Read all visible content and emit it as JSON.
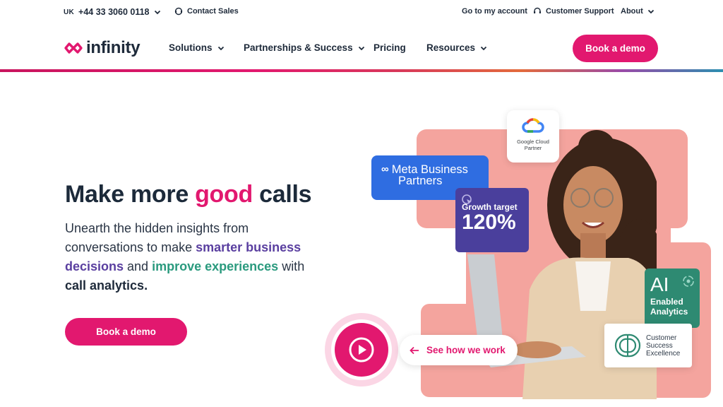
{
  "topbar": {
    "region": "UK",
    "phone": "+44 33 3060 0118",
    "contact_sales": "Contact Sales",
    "account": "Go to my account",
    "support": "Customer Support",
    "about": "About"
  },
  "nav": {
    "logo": "infinity",
    "solutions": "Solutions",
    "partnerships": "Partnerships & Success",
    "pricing": "Pricing",
    "resources": "Resources",
    "cta": "Book a demo"
  },
  "hero": {
    "headline_pre": "Make more ",
    "headline_accent": "good",
    "headline_post": " calls",
    "sub_1": "Unearth the hidden insights from conversations to make ",
    "sub_2": "smarter business decisions",
    "sub_3": " and ",
    "sub_4": "improve experiences",
    "sub_5": " with ",
    "sub_6": "call analytics.",
    "cta": "Book a demo"
  },
  "badges": {
    "google_line1": "Google Cloud",
    "google_line2": "Partner",
    "meta_line1": "Meta Business",
    "meta_line2": "Partners",
    "growth_label": "Growth target",
    "growth_value": "120%",
    "ai_big": "AI",
    "ai_line1": "Enabled",
    "ai_line2": "Analytics",
    "cse_line1": "Customer",
    "cse_line2": "Success",
    "cse_line3": "Excellence",
    "see_work": "See how we work"
  },
  "colors": {
    "brand_pink": "#e2186f",
    "navy": "#1e2a3a",
    "purple": "#5a3fa0",
    "green": "#2a9a7e",
    "salmon": "#f4a49e",
    "meta_blue": "#2f6de1"
  }
}
